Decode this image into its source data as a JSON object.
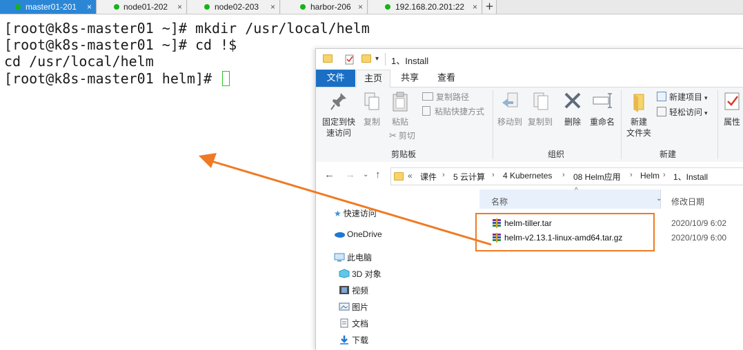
{
  "tabs": [
    {
      "label": "master01-201",
      "active": true
    },
    {
      "label": "node01-202",
      "active": false
    },
    {
      "label": "node02-203",
      "active": false
    },
    {
      "label": "harbor-206",
      "active": false
    },
    {
      "label": "192.168.20.201:22",
      "active": false
    }
  ],
  "tab_close": "×",
  "tab_add": "+",
  "terminal": {
    "lines": [
      "[root@k8s-master01 ~]# mkdir /usr/local/helm",
      "[root@k8s-master01 ~]# cd !$",
      "cd /usr/local/helm",
      "[root@k8s-master01 helm]# "
    ],
    "cursor_color": "#27c427"
  },
  "explorer": {
    "title": "1、Install",
    "ribbon_tabs": {
      "file": "文件",
      "home": "主页",
      "share": "共享",
      "view": "查看"
    },
    "clipboard": {
      "pin": "固定到快速访问",
      "pin_line1": "固定到快",
      "pin_line2": "速访问",
      "copy": "复制",
      "paste": "粘贴",
      "copy_path": "复制路径",
      "paste_shortcut": "粘贴快捷方式",
      "cut": "剪切",
      "group": "剪贴板"
    },
    "organize": {
      "move_to": "移动到",
      "copy_to": "复制到",
      "delete": "删除",
      "rename": "重命名",
      "group": "组织"
    },
    "new": {
      "new_folder_line1": "新建",
      "new_folder_line2": "文件夹",
      "new_item": "新建项目",
      "easy_access": "轻松访问",
      "group": "新建"
    },
    "open": {
      "properties": "属性"
    },
    "breadcrumb": [
      "课件",
      "5 云计算",
      "4 Kubernetes",
      "08 Helm应用",
      "Helm",
      "1、Install"
    ],
    "breadcrumb_prefix": "«",
    "nav_pane": [
      "快速访问",
      "OneDrive",
      "此电脑",
      "3D 对象",
      "视频",
      "图片",
      "文档",
      "下载"
    ],
    "columns": {
      "name": "名称",
      "modified": "修改日期"
    },
    "files": [
      {
        "name": "helm-tiller.tar",
        "date": "2020/10/9 6:02"
      },
      {
        "name": "helm-v2.13.1-linux-amd64.tar.gz",
        "date": "2020/10/9 6:00"
      }
    ]
  },
  "annotation": {
    "color": "#ef7a22"
  }
}
